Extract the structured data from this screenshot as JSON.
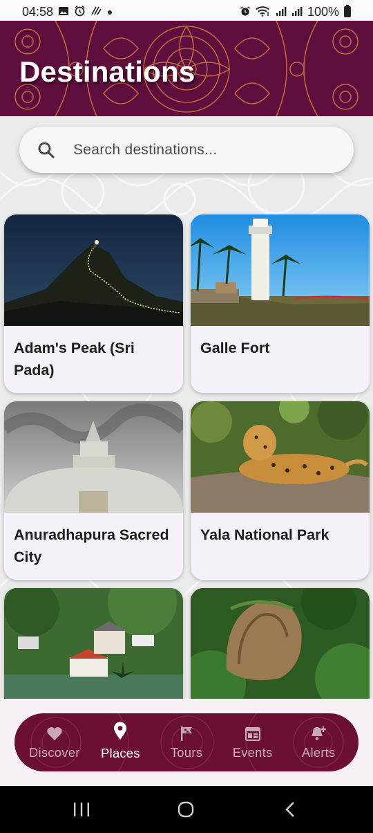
{
  "status_bar": {
    "time": "04:58",
    "battery": "100%"
  },
  "header": {
    "title": "Destinations"
  },
  "search": {
    "placeholder": "Search destinations..."
  },
  "destinations": [
    {
      "name": "Adam's Peak (Sri Pada)"
    },
    {
      "name": "Galle Fort"
    },
    {
      "name": "Anuradhapura Sacred City"
    },
    {
      "name": "Yala National Park"
    }
  ],
  "bottom_nav": {
    "items": [
      {
        "label": "Discover",
        "icon": "heart-icon"
      },
      {
        "label": "Places",
        "icon": "location-pin-icon"
      },
      {
        "label": "Tours",
        "icon": "flag-icon"
      },
      {
        "label": "Events",
        "icon": "calendar-icon"
      },
      {
        "label": "Alerts",
        "icon": "bell-plus-icon"
      }
    ],
    "active": "Places"
  },
  "colors": {
    "header_bg": "#5e0f3e",
    "pattern": "#c86a3a",
    "nav_bg": "#6b0f35",
    "card_bg": "#f6f1f8"
  }
}
